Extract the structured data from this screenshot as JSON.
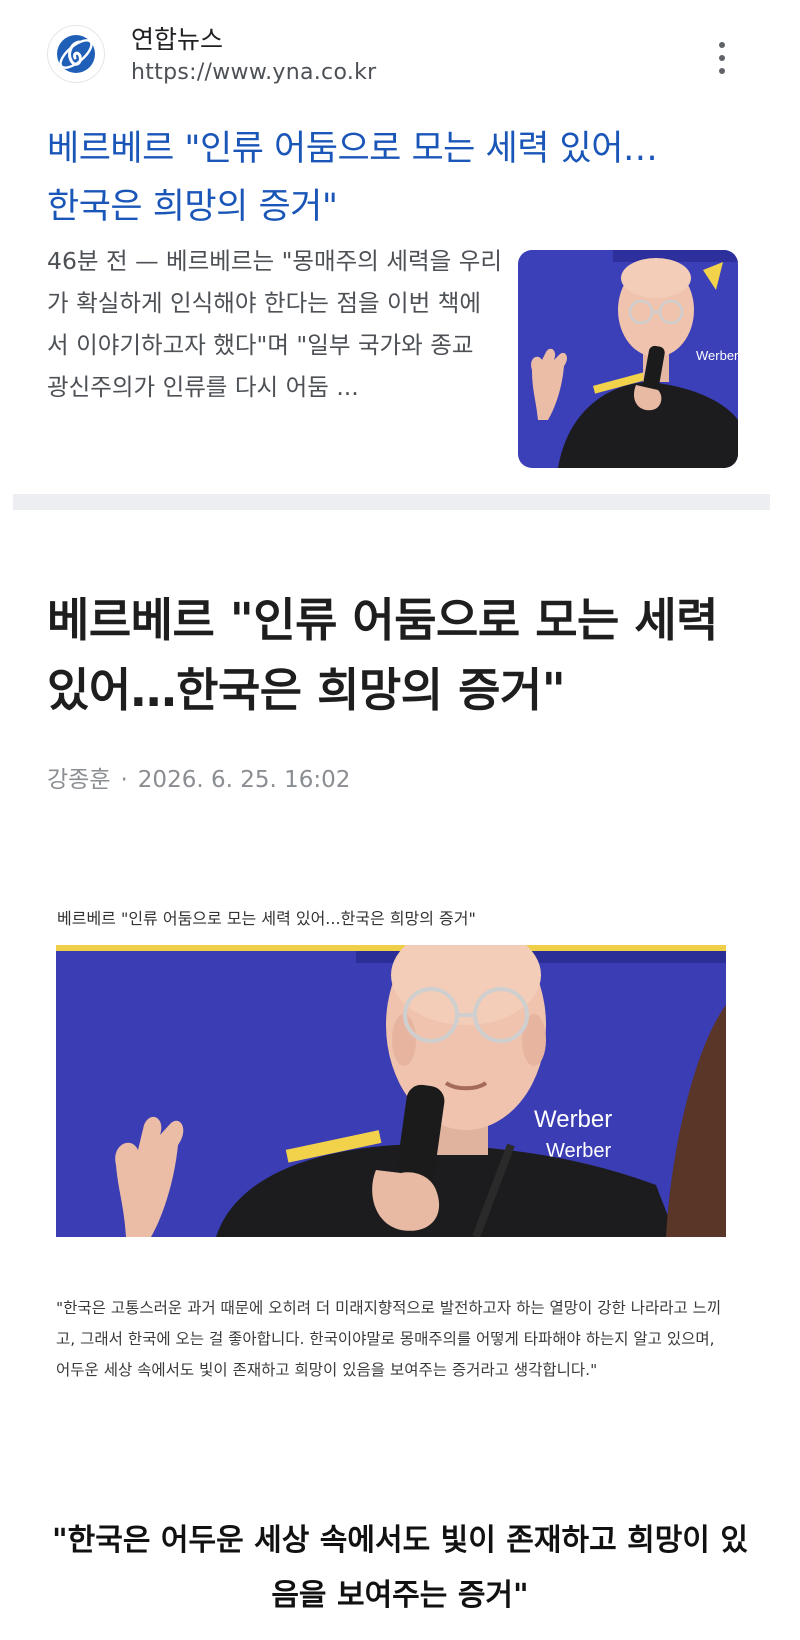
{
  "source": {
    "name": "연합뉴스",
    "url": "https://www.yna.co.kr",
    "favicon": "yna-logo-icon",
    "more_icon": "more-vert-icon"
  },
  "result": {
    "title": "베르베르 \"인류 어둠으로 모는 세력 있어…한국은 희망의 증거\"",
    "snippet": "46분 전 — 베르베르는 \"몽매주의 세력을 우리가 확실하게 인식해야 한다는 점을 이번 책에서 이야기하고자 했다\"며 \"일부 국가와 종교 광신주의가 인류를 다시 어둠 ...",
    "link_color": "#1a56b8"
  },
  "article": {
    "title": "베르베르 \"인류 어둠으로 모는 세력 있어…한국은 희망의 증거\"",
    "author": "강종훈",
    "separator": "·",
    "datetime": "2026. 6. 25. 16:02",
    "caption": "베르베르 \"인류 어둠으로 모는 세력 있어...한국은 희망의 증거\"",
    "photo_sign_text": "Werber",
    "quote": "\"한국은 고통스러운 과거 때문에 오히려 더 미래지향적으로 발전하고자 하는 열망이 강한 나라라고 느끼고, 그래서 한국에 오는 걸 좋아합니다. 한국이야말로 몽매주의를 어떻게 타파해야 하는지 알고 있으며, 어두운 세상 속에서도 빛이 존재하고 희망이 있음을 보여주는 증거라고 생각합니다.\"",
    "pull_quote": "\"한국은 어두운 세상 속에서도 빛이 존재하고 희망이 있음을 보여주는 증거\""
  }
}
